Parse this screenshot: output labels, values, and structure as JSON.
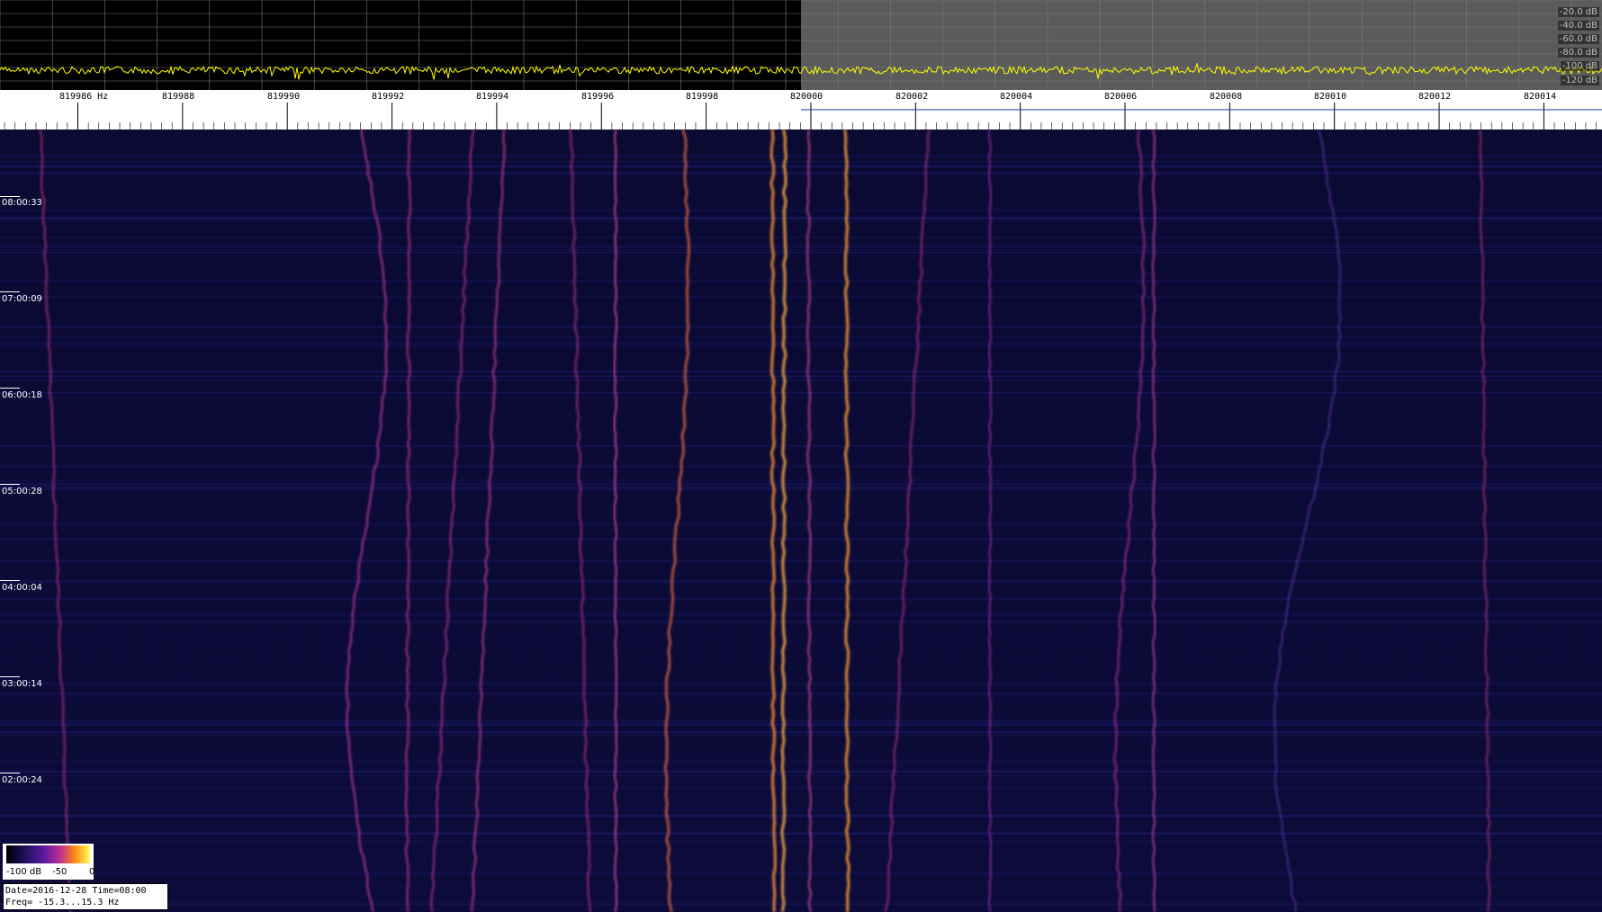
{
  "spectrum": {
    "db_scale": [
      "-20.0 dB",
      "-40.0 dB",
      "-60.0 dB",
      "-80.0 dB",
      "-100 dB",
      "-120 dB"
    ],
    "trace_color": "#ffff00",
    "left_bg": "#000000",
    "right_bg": "#5b5b5b"
  },
  "frequency_axis": {
    "labels": [
      "819986 Hz",
      "819988",
      "819990",
      "819992",
      "819994",
      "819996",
      "819998",
      "820000",
      "820002",
      "820004",
      "820006",
      "820008",
      "820010",
      "820012",
      "820014"
    ]
  },
  "waterfall": {
    "time_labels": [
      "08:00:33",
      "07:00:09",
      "06:00:18",
      "05:00:28",
      "04:00:04",
      "03:00:14",
      "02:00:24"
    ],
    "background": "#0a0930"
  },
  "colorbar": {
    "labels": [
      "-100 dB",
      "-50",
      "0"
    ]
  },
  "info": {
    "line1": "Date=2016-12-28 Time=08:00",
    "line2": "Freq= -15.3...15.3 Hz"
  }
}
